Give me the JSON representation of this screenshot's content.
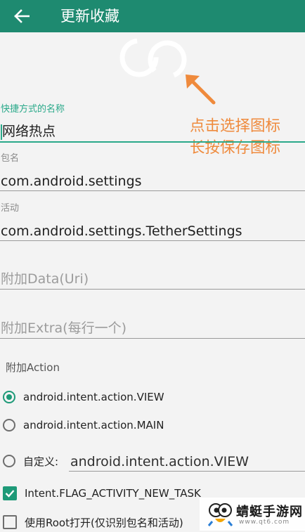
{
  "appbar": {
    "title": "更新收藏",
    "back_icon": "arrow-left-icon"
  },
  "icon_picker": {
    "icon": "loading-rings-icon"
  },
  "hint": {
    "line1": "点击选择图标",
    "line2": "长按保存图标",
    "color": "#ef8a3c"
  },
  "fields": {
    "shortcut_name": {
      "label": "快捷方式的名称",
      "value": "网络热点"
    },
    "package": {
      "label": "包名",
      "value": "com.android.settings"
    },
    "activity": {
      "label": "活动",
      "value": "com.android.settings.TetherSettings"
    },
    "data_uri": {
      "placeholder": "附加Data(Uri)"
    },
    "extra": {
      "placeholder": "附加Extra(每行一个)"
    }
  },
  "action": {
    "section_label": "附加Action",
    "options": [
      {
        "label": "android.intent.action.VIEW",
        "checked": true
      },
      {
        "label": "android.intent.action.MAIN",
        "checked": false
      }
    ],
    "custom": {
      "label": "自定义:",
      "value": "android.intent.action.VIEW",
      "checked": false
    }
  },
  "flags": [
    {
      "label": "Intent.FLAG_ACTIVITY_NEW_TASK",
      "checked": true
    },
    {
      "label": "使用Root打开(仅识别包名和活动)",
      "checked": false
    }
  ],
  "watermark": {
    "text": "蜻蜓手游网",
    "sub": "www.qt6.com"
  },
  "colors": {
    "appbar": "#1e8a70",
    "accent": "#2aa98a",
    "hint": "#ef8a3c"
  }
}
